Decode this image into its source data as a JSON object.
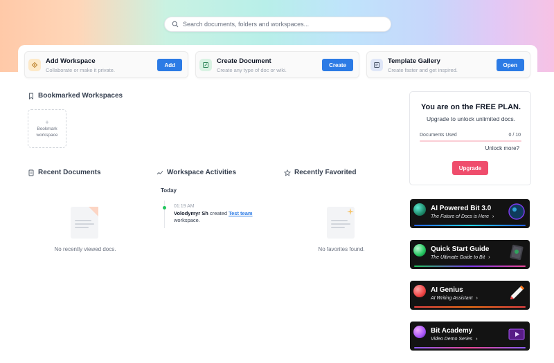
{
  "search": {
    "placeholder": "Search documents, folders and workspaces..."
  },
  "quick_actions": [
    {
      "title": "Add Workspace",
      "subtitle": "Collaborate or make it private.",
      "button": "Add",
      "icon": "workspace-icon",
      "icon_bg": "#fde9c8"
    },
    {
      "title": "Create Document",
      "subtitle": "Create any type of doc or wiki.",
      "button": "Create",
      "icon": "edit-document-icon",
      "icon_bg": "#d9f2e3"
    },
    {
      "title": "Template Gallery",
      "subtitle": "Create faster and get inspired.",
      "button": "Open",
      "icon": "template-icon",
      "icon_bg": "#dfe6f7"
    }
  ],
  "bookmarked": {
    "title": "Bookmarked Workspaces",
    "add_plus": "+",
    "add_label_line1": "Bookmark",
    "add_label_line2": "workspace"
  },
  "recent_documents": {
    "title": "Recent Documents",
    "empty": "No recently viewed docs."
  },
  "workspace_activities": {
    "title": "Workspace Activities",
    "group": "Today",
    "items": [
      {
        "time": "01:19 AM",
        "user": "Volodymyr Sh",
        "action": "created",
        "target": "Test team",
        "suffix": "workspace."
      }
    ]
  },
  "recently_favorited": {
    "title": "Recently Favorited",
    "empty": "No favorites found."
  },
  "plan": {
    "title": "You are on the FREE PLAN.",
    "subtitle": "Upgrade to unlock unlimited docs.",
    "usage_label": "Documents Used",
    "usage_count": "0 / 10",
    "usage_fraction": 0,
    "more_link": "Unlock more?",
    "button": "Upgrade",
    "accent": "#ef4d6c"
  },
  "promos": [
    {
      "title": "AI Powered Bit 3.0",
      "subtitle": "The Future of Docs is Here",
      "arrow": "›",
      "orb": "#1f8a6a",
      "stripe": "#2563eb"
    },
    {
      "title": "Quick Start Guide",
      "subtitle": "The Ultimate Guide to Bit",
      "arrow": "›",
      "orb": "#22c55e",
      "stripe": "#7c3aed"
    },
    {
      "title": "AI Genius",
      "subtitle": "AI Writing Assistant",
      "arrow": "›",
      "orb": "#ef4444",
      "stripe": "#ef4444"
    },
    {
      "title": "Bit Academy",
      "subtitle": "Video Demo Series",
      "arrow": "›",
      "orb": "#a855f7",
      "stripe": "#8b5cf6"
    }
  ]
}
